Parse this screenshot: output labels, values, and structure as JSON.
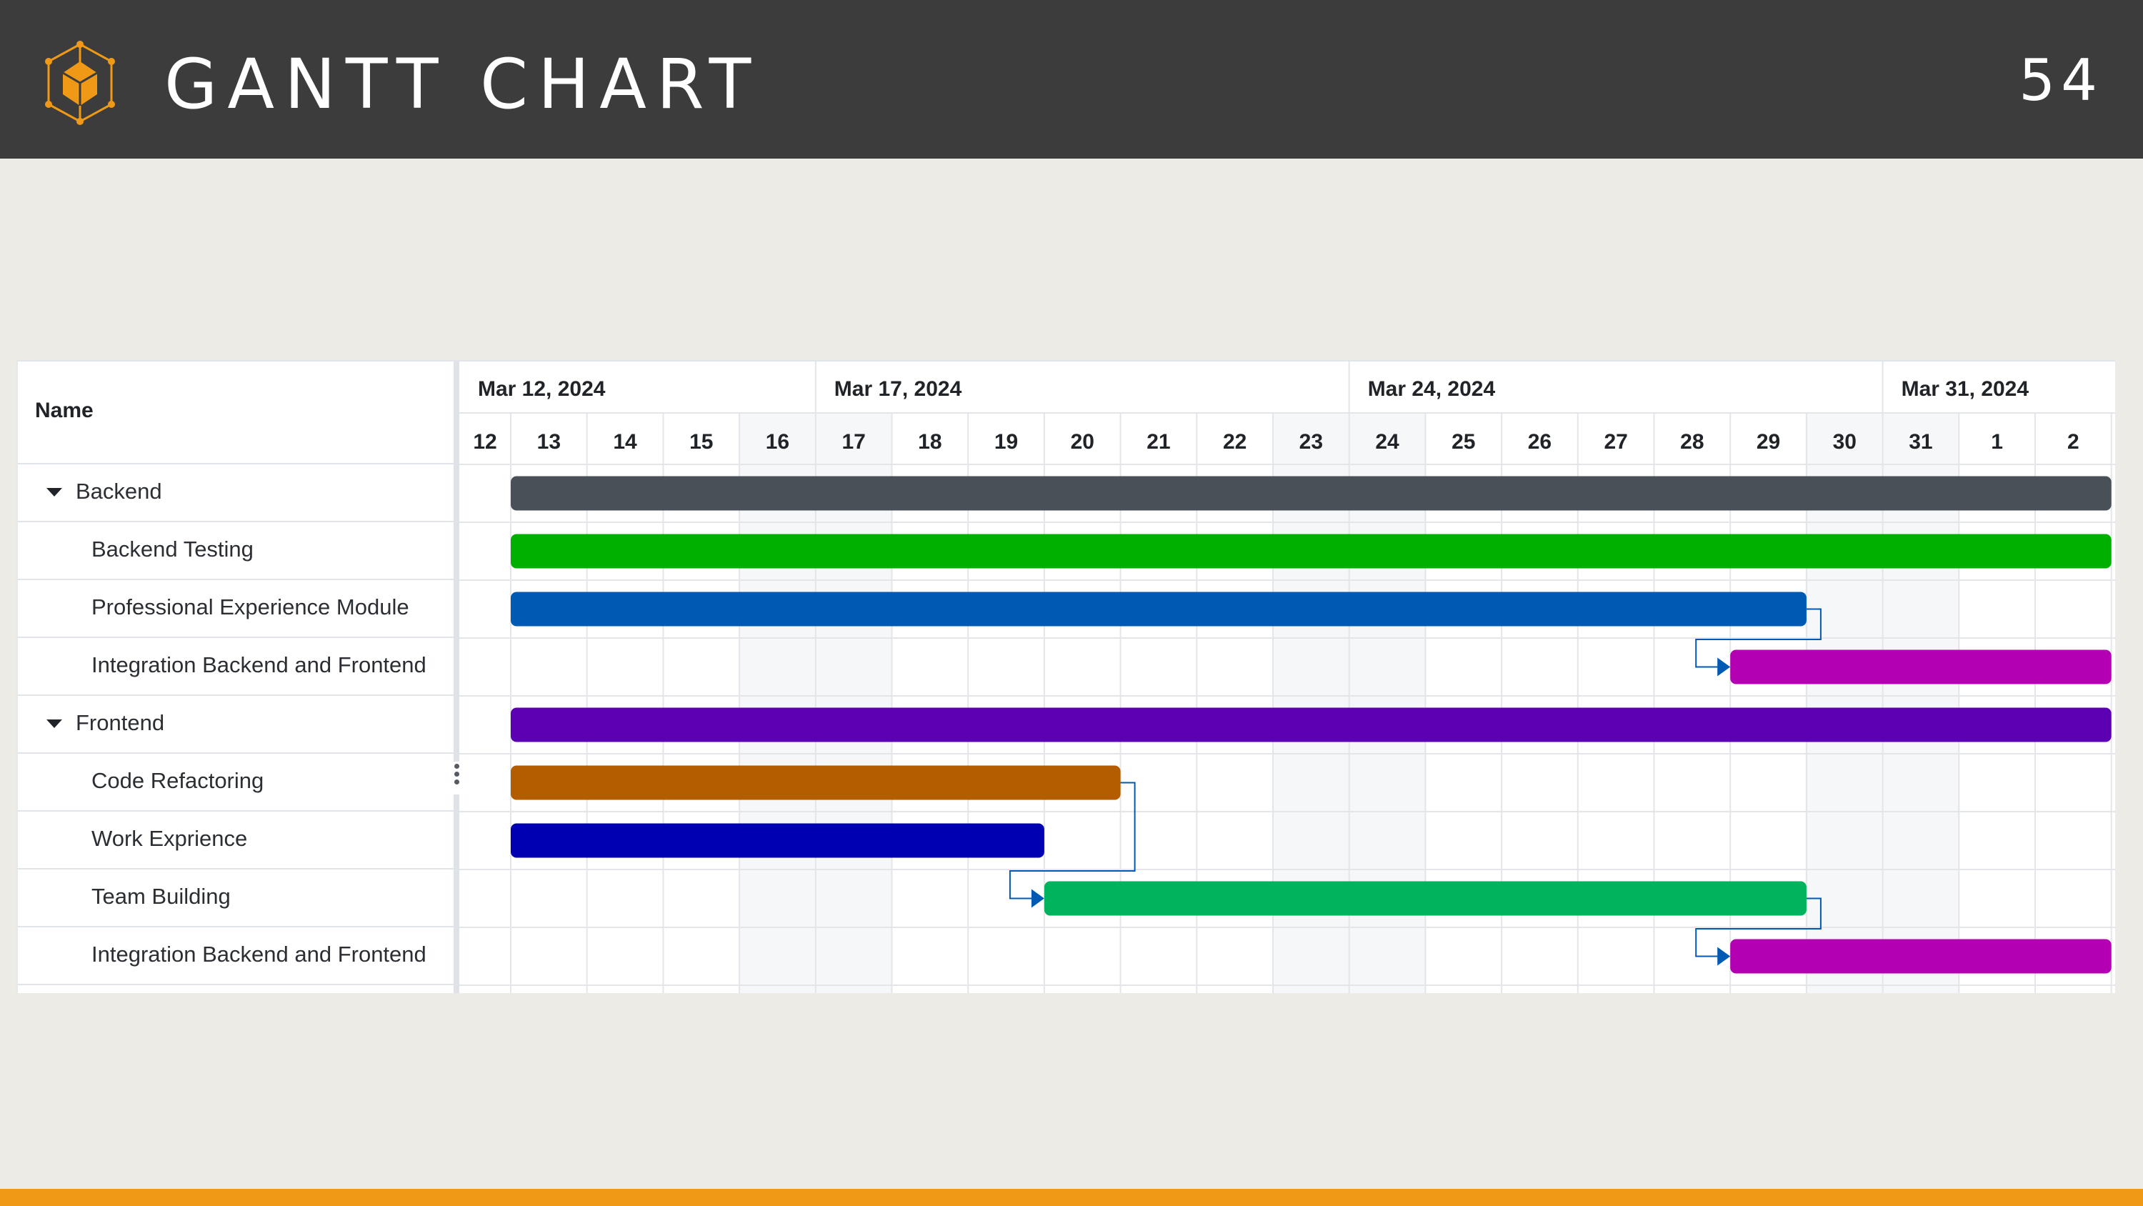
{
  "slide": {
    "title": "GANTT CHART",
    "page_number": "54",
    "logo_icon": "cube-network-icon",
    "colors": {
      "topbar": "#3c3c3c",
      "background": "#ecebe6",
      "accent": "#ef9916"
    }
  },
  "grid": {
    "header": "Name",
    "rows": [
      {
        "label": "Backend",
        "type": "group",
        "expanded": true
      },
      {
        "label": "Backend Testing",
        "type": "task"
      },
      {
        "label": "Professional Experience Module",
        "type": "task"
      },
      {
        "label": "Integration Backend and Frontend",
        "type": "task"
      },
      {
        "label": "Frontend",
        "type": "group",
        "expanded": true
      },
      {
        "label": "Code Refactoring",
        "type": "task"
      },
      {
        "label": "Work Exprience",
        "type": "task"
      },
      {
        "label": "Team Building",
        "type": "task"
      },
      {
        "label": "Integration Backend and Frontend",
        "type": "task"
      }
    ]
  },
  "chart_data": {
    "type": "gantt",
    "title": "GANTT CHART",
    "week_labels": [
      {
        "label": "Mar 12, 2024",
        "start": "2024-03-12"
      },
      {
        "label": "Mar 17, 2024",
        "start": "2024-03-17"
      },
      {
        "label": "Mar 24, 2024",
        "start": "2024-03-24"
      },
      {
        "label": "Mar 31, 2024",
        "start": "2024-03-31"
      }
    ],
    "day_labels": [
      "12",
      "13",
      "14",
      "15",
      "16",
      "17",
      "18",
      "19",
      "20",
      "21",
      "22",
      "23",
      "24",
      "25",
      "26",
      "27",
      "28",
      "29",
      "30",
      "31",
      "1",
      "2"
    ],
    "weekend_days": [
      "16",
      "17",
      "23",
      "24",
      "30",
      "31"
    ],
    "x_range": [
      "2024-03-12",
      "2024-04-02"
    ],
    "tasks": [
      {
        "name": "Backend",
        "type": "summary",
        "start": "2024-03-13",
        "end": "2024-04-02",
        "color": "#4a5058"
      },
      {
        "name": "Backend Testing",
        "start": "2024-03-13",
        "end": "2024-04-02",
        "color": "#00b000"
      },
      {
        "name": "Professional Experience Module",
        "start": "2024-03-13",
        "end": "2024-03-29",
        "color": "#0059b3"
      },
      {
        "name": "Integration Backend and Frontend",
        "start": "2024-03-29",
        "end": "2024-04-02",
        "color": "#b300b3"
      },
      {
        "name": "Frontend",
        "type": "summary",
        "start": "2024-03-13",
        "end": "2024-04-02",
        "color": "#5b00b3"
      },
      {
        "name": "Code Refactoring",
        "start": "2024-03-13",
        "end": "2024-03-20",
        "color": "#b35c00"
      },
      {
        "name": "Work Exprience",
        "start": "2024-03-13",
        "end": "2024-03-19",
        "color": "#0000b3"
      },
      {
        "name": "Team Building",
        "start": "2024-03-20",
        "end": "2024-03-29",
        "color": "#00b35c"
      },
      {
        "name": "Integration Backend and Frontend",
        "start": "2024-03-29",
        "end": "2024-04-02",
        "color": "#b300b3"
      }
    ],
    "dependencies": [
      {
        "from": 2,
        "to": 3,
        "type": "finish-to-start"
      },
      {
        "from": 5,
        "to": 7,
        "type": "finish-to-start"
      },
      {
        "from": 7,
        "to": 8,
        "type": "finish-to-start"
      }
    ],
    "dependency_color": "#0059b3",
    "grid": true
  }
}
